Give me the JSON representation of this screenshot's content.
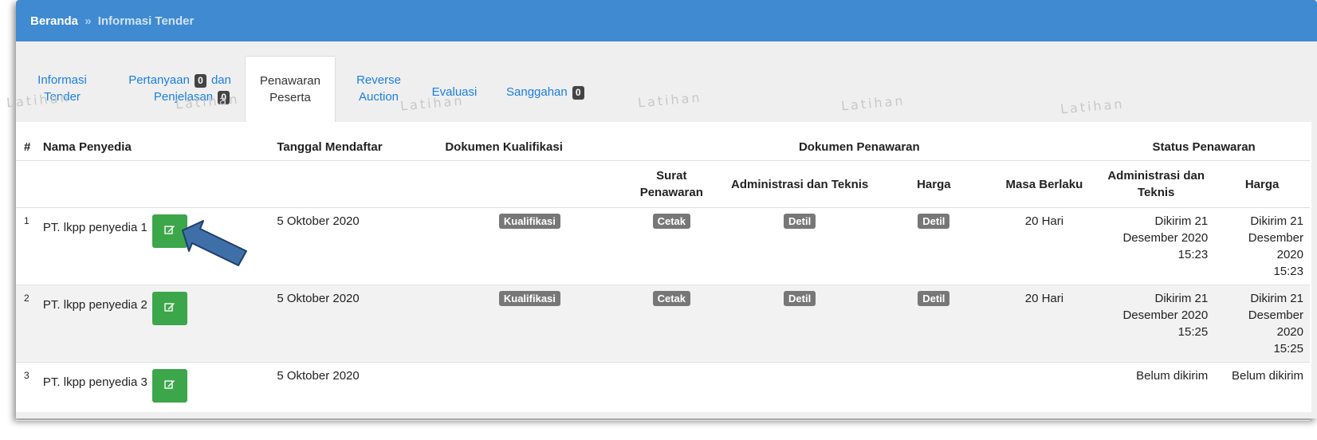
{
  "breadcrumb": {
    "home": "Beranda",
    "separator": "»",
    "current": "Informasi Tender"
  },
  "tabs": [
    {
      "line1": "Informasi",
      "line2": "Tender"
    },
    {
      "line1_pre": "Pertanyaan",
      "badge1": "0",
      "line1_post": "dan",
      "line2": "Penjelasan",
      "badge2": "0"
    },
    {
      "line1": "Penawaran",
      "line2": "Peserta"
    },
    {
      "line1": "Reverse",
      "line2": "Auction"
    },
    {
      "line1": "Evaluasi"
    },
    {
      "label": "Sanggahan",
      "badge": "0"
    }
  ],
  "watermark": "Latihan",
  "table": {
    "headers": {
      "num": "#",
      "provider": "Nama Penyedia",
      "date": "Tanggal Mendaftar",
      "qualification": "Dokumen Kualifikasi",
      "offer_docs": "Dokumen Penawaran",
      "status": "Status Penawaran",
      "offer_letter": "Surat Penawaran",
      "admin_tech": "Administrasi dan Teknis",
      "price": "Harga",
      "validity": "Masa Berlaku",
      "status_admin": "Administrasi dan Teknis",
      "status_price": "Harga"
    },
    "rows": [
      {
        "num": "1",
        "provider": "PT. lkpp penyedia 1",
        "date": "5 Oktober 2020",
        "qualification": "Kualifikasi",
        "offer_letter": "Cetak",
        "admin_tech": "Detil",
        "price": "Detil",
        "validity": "20 Hari",
        "status_admin": [
          "Dikirim 21",
          "Desember 2020",
          "15:23"
        ],
        "status_price": [
          "Dikirim 21",
          "Desember 2020",
          "15:23"
        ]
      },
      {
        "num": "2",
        "provider": "PT. lkpp penyedia 2",
        "date": "5 Oktober 2020",
        "qualification": "Kualifikasi",
        "offer_letter": "Cetak",
        "admin_tech": "Detil",
        "price": "Detil",
        "validity": "20 Hari",
        "status_admin": [
          "Dikirim 21",
          "Desember 2020",
          "15:25"
        ],
        "status_price": [
          "Dikirim 21",
          "Desember 2020",
          "15:25"
        ]
      },
      {
        "num": "3",
        "provider": "PT. lkpp penyedia 3",
        "date": "5 Oktober 2020",
        "qualification": "",
        "offer_letter": "",
        "admin_tech": "",
        "price": "",
        "validity": "",
        "status_admin": [
          "Belum dikirim"
        ],
        "status_price": [
          "Belum dikirim"
        ]
      }
    ]
  },
  "colors": {
    "header_bar": "#3f8ad0",
    "link": "#1a7fe0",
    "edit_button": "#3ca64a",
    "arrow": "#3f6fa8"
  }
}
